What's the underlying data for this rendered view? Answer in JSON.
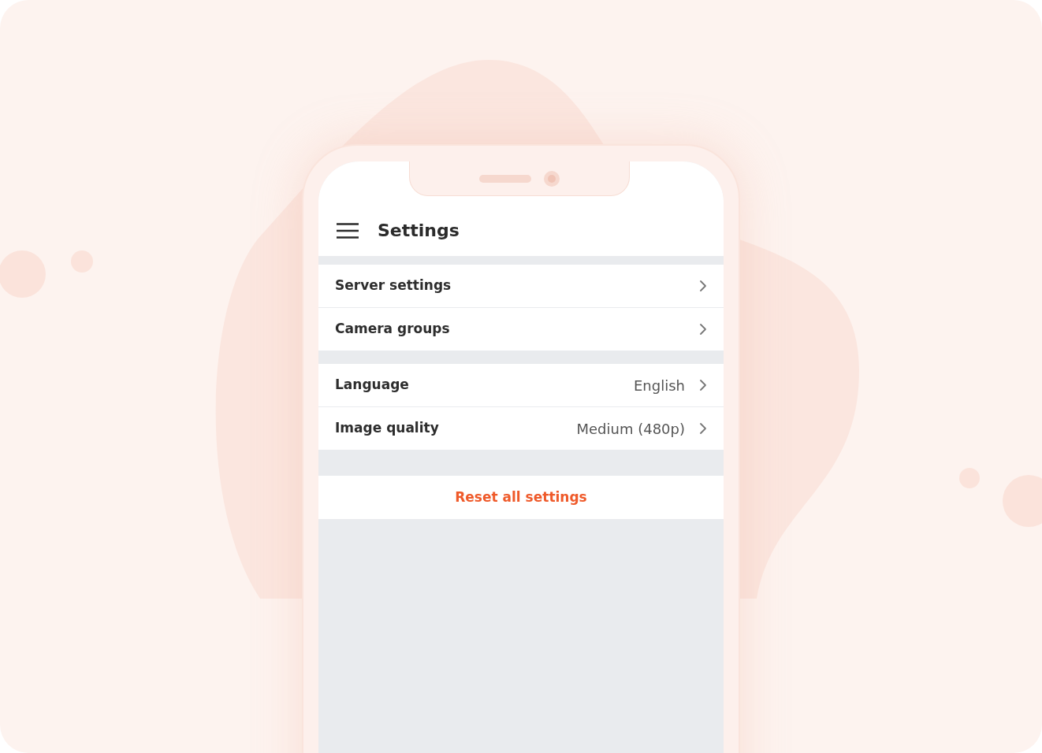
{
  "header": {
    "title": "Settings"
  },
  "sections": [
    {
      "items": [
        {
          "label": "Server settings"
        },
        {
          "label": "Camera groups"
        }
      ]
    },
    {
      "items": [
        {
          "label": "Language",
          "value": "English"
        },
        {
          "label": "Image quality",
          "value": "Medium (480p)"
        }
      ]
    }
  ],
  "reset_button": {
    "label": "Reset all settings"
  }
}
